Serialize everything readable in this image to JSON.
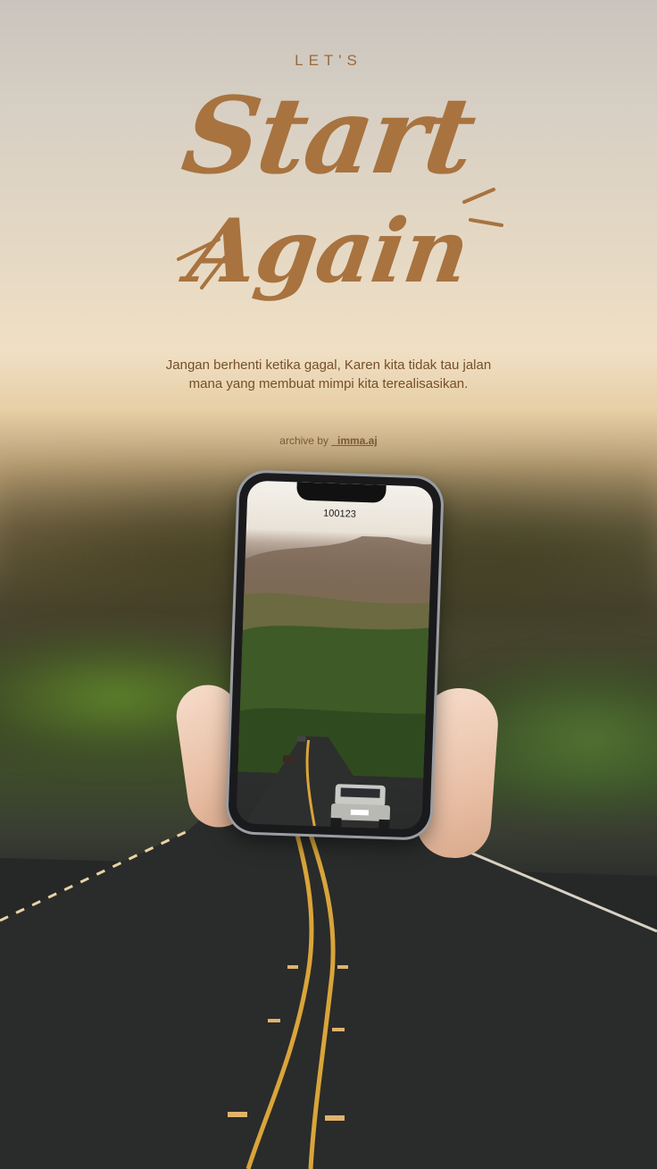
{
  "poster": {
    "lets": "LET'S",
    "title_line1": "Start",
    "title_line2": "Again",
    "tagline": "Jangan berhenti ketika gagal, Karen kita tidak tau jalan mana yang membuat mimpi kita terealisasikan.",
    "credit_prefix": "archive by",
    "credit_handle": "_imma.aj"
  },
  "phone": {
    "time": "100123"
  },
  "colors": {
    "accent_brown": "#a8733f",
    "road": "#262727",
    "road_line_yellow": "#d9a53a"
  }
}
